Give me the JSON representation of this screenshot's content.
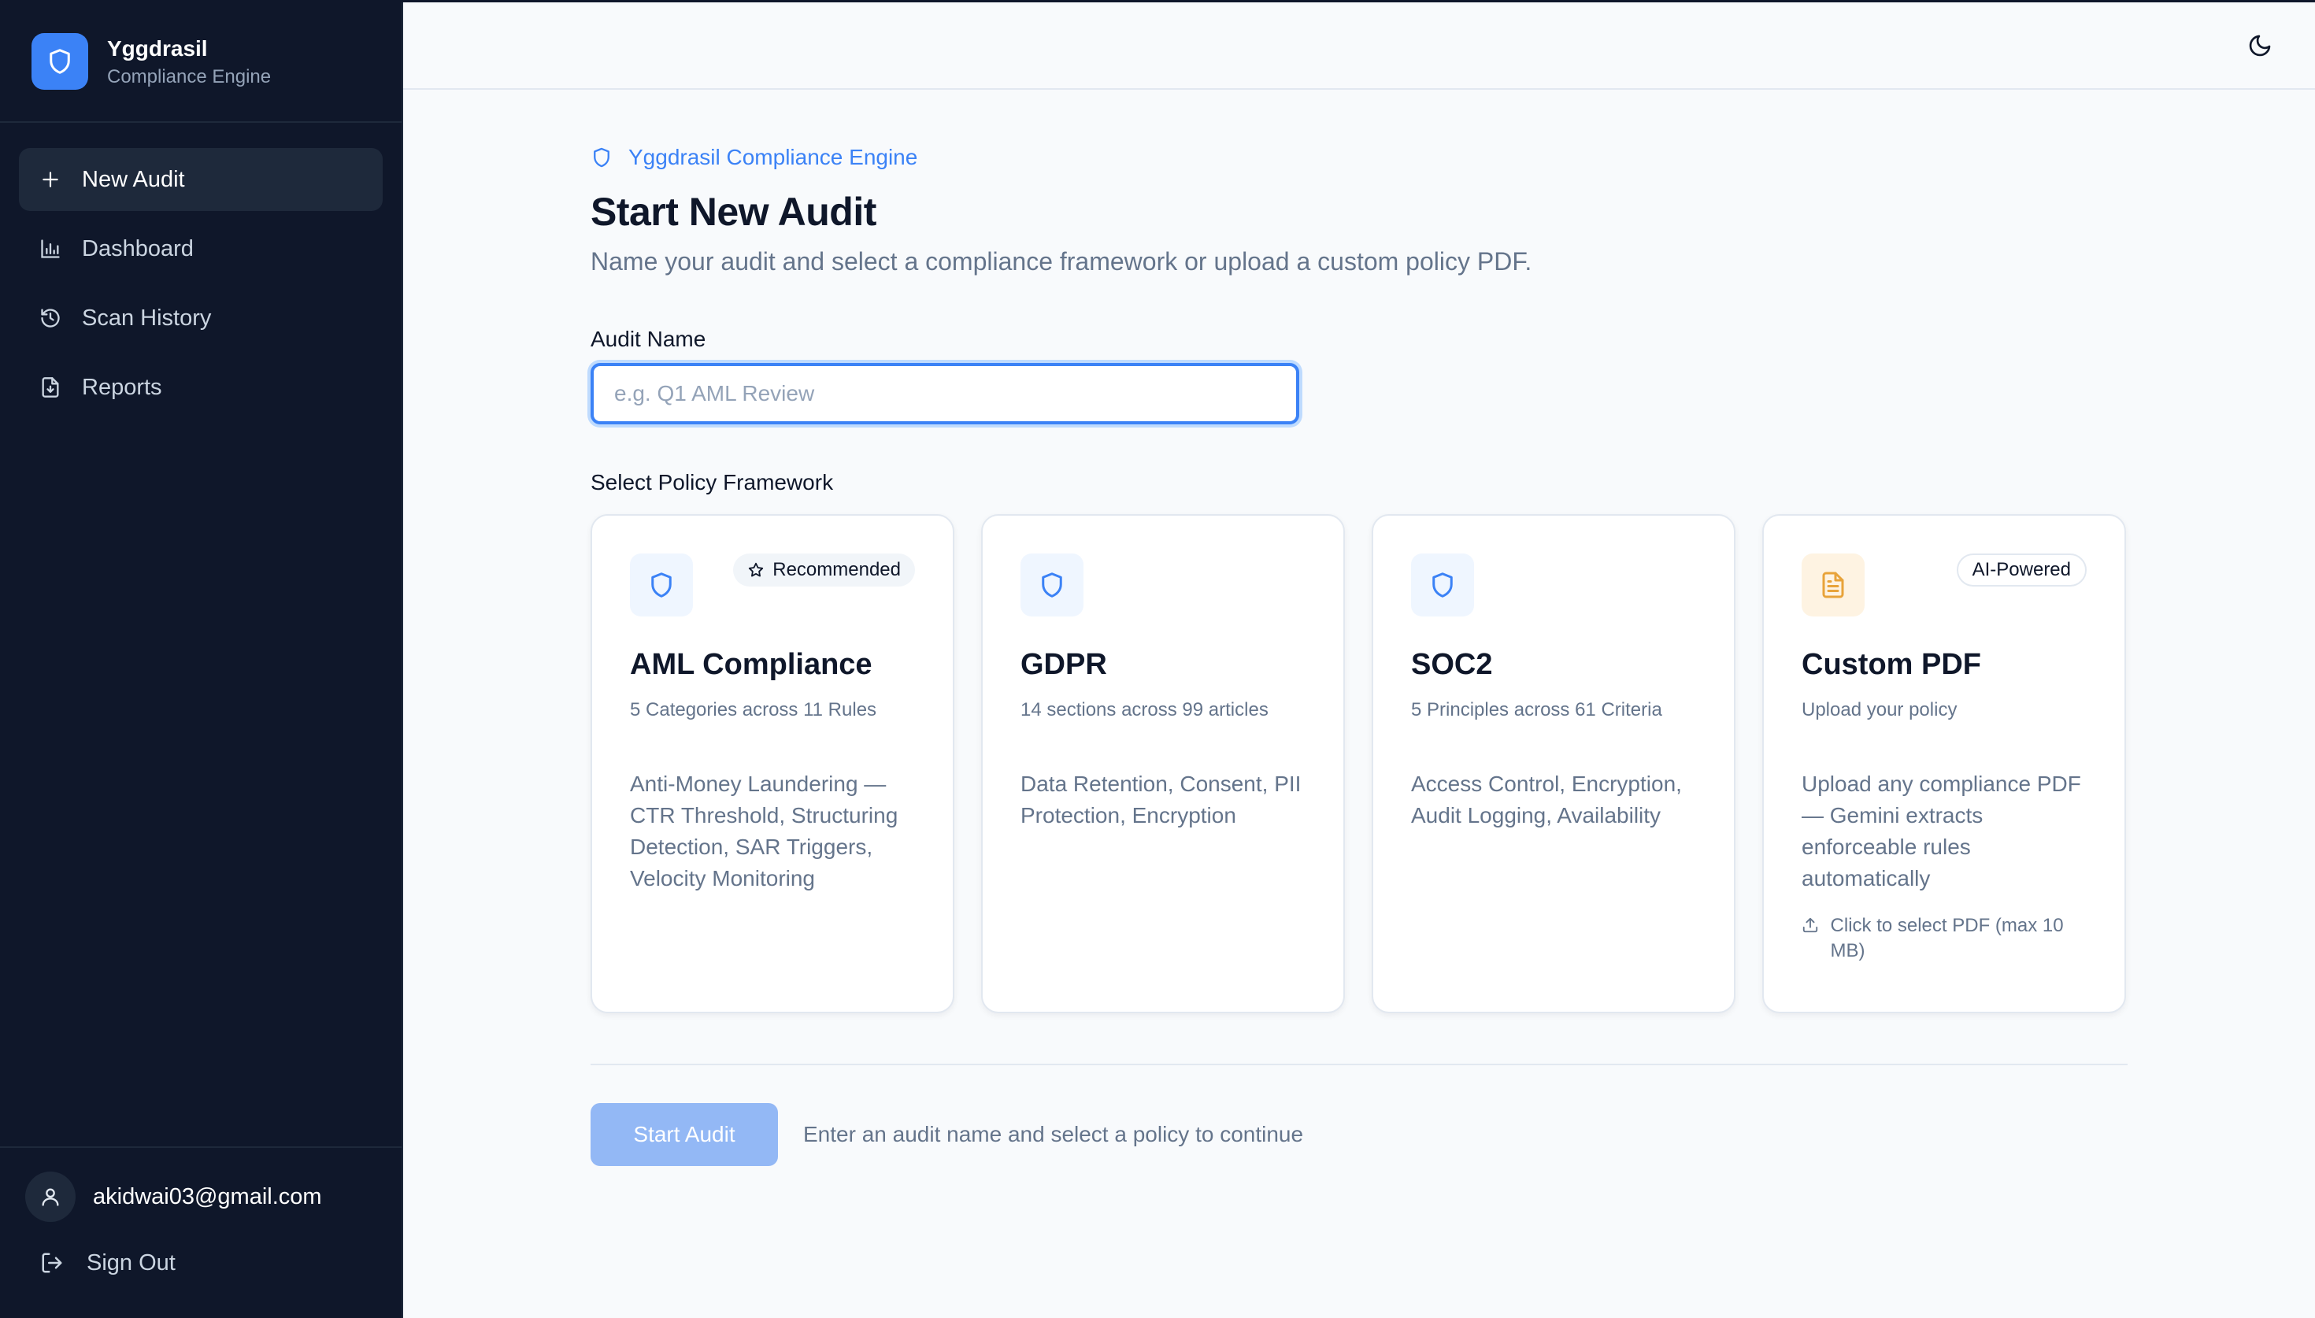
{
  "app": {
    "name": "Yggdrasil",
    "subtitle": "Compliance Engine"
  },
  "sidebar": {
    "items": [
      {
        "label": "New Audit",
        "icon": "plus-icon",
        "active": true
      },
      {
        "label": "Dashboard",
        "icon": "bar-chart-icon"
      },
      {
        "label": "Scan History",
        "icon": "history-icon"
      },
      {
        "label": "Reports",
        "icon": "file-download-icon"
      }
    ],
    "user_email": "akidwai03@gmail.com",
    "sign_out": "Sign Out"
  },
  "header": {
    "theme_toggle_icon": "moon-icon"
  },
  "main": {
    "eyebrow": "Yggdrasil Compliance Engine",
    "title": "Start New Audit",
    "description": "Name your audit and select a compliance framework or upload a custom policy PDF.",
    "audit_name_label": "Audit Name",
    "audit_name_value": "",
    "audit_name_placeholder": "e.g. Q1 AML Review",
    "framework_label": "Select Policy Framework",
    "cards": [
      {
        "title": "AML Compliance",
        "subtitle": "5 Categories across 11 Rules",
        "description": "Anti-Money Laundering — CTR Threshold, Structuring Detection, SAR Triggers, Velocity Monitoring",
        "badge": "Recommended",
        "icon": "shield-icon"
      },
      {
        "title": "GDPR",
        "subtitle": "14 sections across 99 articles",
        "description": "Data Retention, Consent, PII Protection, Encryption",
        "icon": "shield-icon"
      },
      {
        "title": "SOC2",
        "subtitle": "5 Principles across 61 Criteria",
        "description": "Access Control, Encryption, Audit Logging, Availability",
        "icon": "shield-icon"
      },
      {
        "title": "Custom PDF",
        "subtitle": "Upload your policy",
        "description": "Upload any compliance PDF — Gemini extracts enforceable rules automatically",
        "badge": "AI-Powered",
        "upload_hint": "Click to select PDF (max 10 MB)",
        "icon": "document-icon"
      }
    ],
    "start_button": "Start Audit",
    "hint": "Enter an audit name and select a policy to continue"
  },
  "colors": {
    "sidebar_bg": "#0f172a",
    "accent": "#3b82f6",
    "accent_disabled": "#93b8f5",
    "pdf_accent": "#e8a33a"
  }
}
